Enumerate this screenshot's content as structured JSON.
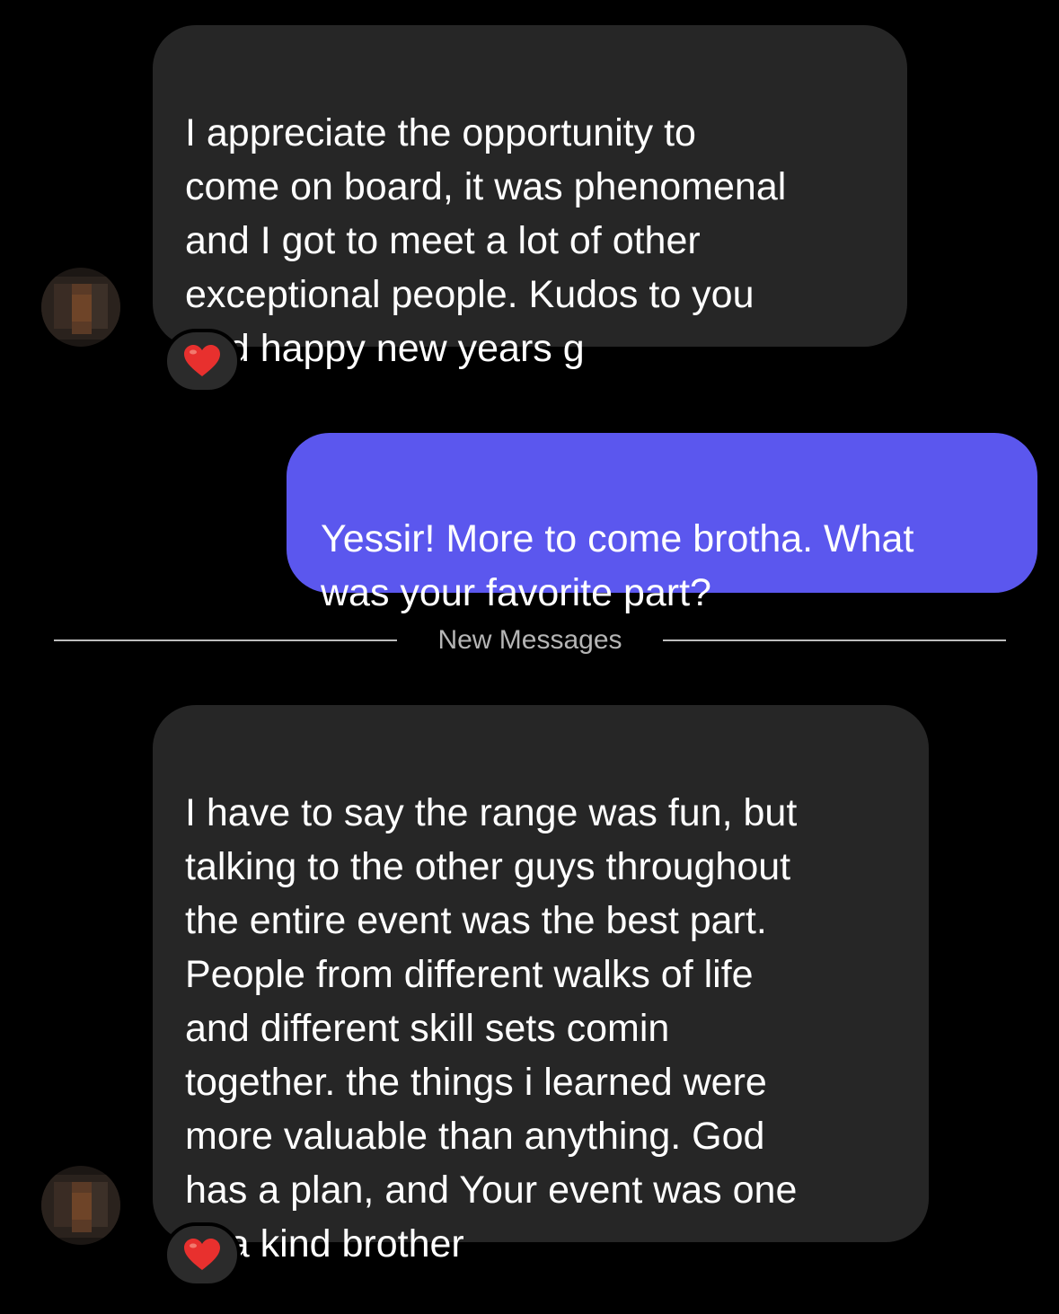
{
  "messages": [
    {
      "sender": "other",
      "text": "I appreciate the opportunity to\ncome on board, it was phenomenal\nand I got to meet a lot of other\nexceptional people. Kudos to you\nand happy new years g",
      "reaction": "heart-emoji"
    },
    {
      "sender": "me",
      "text": "Yessir! More to come brotha. What\nwas your favorite part?"
    },
    {
      "sender": "other",
      "text": "I have to say the range was fun, but\ntalking to the other guys throughout\nthe entire event was the best part.\nPeople from different walks of life\nand different skill sets comin\ntogether. the things i learned were\nmore valuable than anything. God\nhas a plan, and Your event was one\nof a kind brother",
      "reaction": "heart-emoji"
    }
  ],
  "divider": {
    "label": "New Messages"
  },
  "colors": {
    "background": "#000000",
    "incoming_bubble": "#262626",
    "outgoing_bubble": "#5b57ee",
    "reaction_heart": "#e8302e"
  }
}
